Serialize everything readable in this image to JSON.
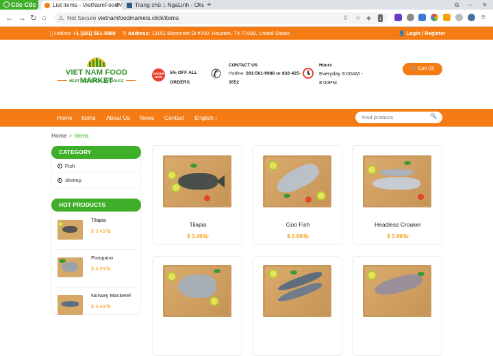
{
  "browser": {
    "brand": "Cốc Cốc",
    "tabs": [
      {
        "label": "List items - VietNamFoodMar",
        "active": true
      },
      {
        "label": "Trang chủ :: NgaLinh - Chuy",
        "active": false
      }
    ],
    "new_tab": "+",
    "security": "Not Secure",
    "url": "vietnamfoodmarkets.click/items"
  },
  "topbar": {
    "hotline_label": "Hotline:",
    "hotline": "+1 (281) 561-9988",
    "address_label": "Address:",
    "address": "13151 Bissonnet St #700, Houston, TX 77099, United States",
    "auth": "Login | Register"
  },
  "header": {
    "logo_name": "VIET NAM FOOD MARKET",
    "logo_tagline": "MEAT - SEAFOOD - PRODUCE",
    "promo_badge": "ORDER NOW",
    "promo_text": "5% OFF ALL ORDERS",
    "contact_title": "CONTACT US",
    "contact_prefix": "Hotline:",
    "contact_value": "281-561-9988 or 832-425-3552",
    "hours_title": "Hours",
    "hours_value": "Everyday 9:00AM - 8:00PM",
    "cart": "Cart (0)"
  },
  "nav": {
    "items": [
      "Home",
      "Items",
      "About Us",
      "News",
      "Contact",
      "English ›"
    ],
    "search_placeholder": "Find products"
  },
  "breadcrumb": {
    "home": "Home",
    "separator": ">",
    "current": "Items"
  },
  "sidebar": {
    "category_title": "CATEGORY",
    "categories": [
      "Fish",
      "Shrimp"
    ],
    "hot_title": "HOT PRODUCTS",
    "hot_products": [
      {
        "name": "Tilapia",
        "price": "$ 3.49/lb"
      },
      {
        "name": "Pompano",
        "price": "$ 4.99/lb"
      },
      {
        "name": "Norway Mackerel",
        "price": "$ 3.99/lb"
      }
    ]
  },
  "products": [
    {
      "name": "Tilapia",
      "price": "$ 3.49/lb",
      "fish_color": "#4a4f4c"
    },
    {
      "name": "Goo Fish",
      "price": "$ 2.99/lb",
      "fish_color": "#b9c0c8"
    },
    {
      "name": "Headless Croaker",
      "price": "$ 3.99/lb",
      "fish_color": "#c7ccd2"
    },
    {
      "name": "",
      "price": "",
      "fish_color": "#a7aeb4"
    },
    {
      "name": "",
      "price": "",
      "fish_color": "#5f6e7e"
    },
    {
      "name": "",
      "price": "",
      "fish_color": "#9a8f98"
    }
  ],
  "colors": {
    "brand_orange": "#f57c14",
    "brand_green": "#3fae29",
    "price": "#f5a623"
  }
}
